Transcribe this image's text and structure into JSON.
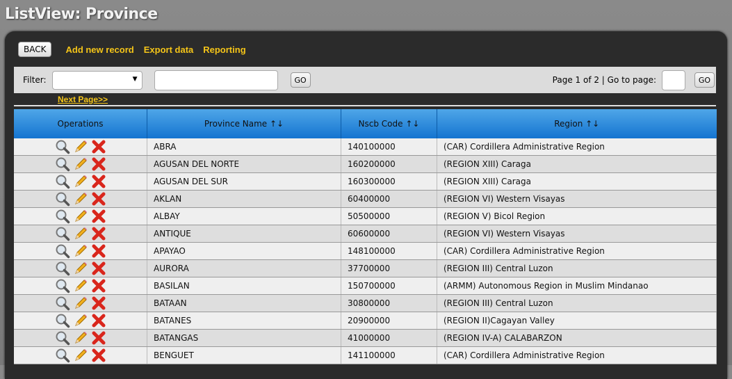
{
  "title": "ListView: Province",
  "toolbar": {
    "back_label": "BACK",
    "links": [
      "Add new record",
      "Export data",
      "Reporting"
    ]
  },
  "filter": {
    "label": "Filter:",
    "select_value": "",
    "search_value": "",
    "go_label": "GO"
  },
  "pager": {
    "text": "Page 1 of 2 | Go to page:",
    "goto_value": "",
    "go_label": "GO",
    "next_label": "Next Page>>"
  },
  "table": {
    "headers": [
      "Operations",
      "Province Name ↑↓",
      "Nscb Code ↑↓",
      "Region ↑↓"
    ],
    "rows": [
      [
        "ABRA",
        "140100000",
        "(CAR) Cordillera Administrative Region"
      ],
      [
        "AGUSAN DEL NORTE",
        "160200000",
        "(REGION XIII) Caraga"
      ],
      [
        "AGUSAN DEL SUR",
        "160300000",
        "(REGION XIII) Caraga"
      ],
      [
        "AKLAN",
        "60400000",
        "(REGION VI) Western Visayas"
      ],
      [
        "ALBAY",
        "50500000",
        "(REGION V) Bicol Region"
      ],
      [
        "ANTIQUE",
        "60600000",
        "(REGION VI) Western Visayas"
      ],
      [
        "APAYAO",
        "148100000",
        "(CAR) Cordillera Administrative Region"
      ],
      [
        "AURORA",
        "37700000",
        "(REGION III) Central Luzon"
      ],
      [
        "BASILAN",
        "150700000",
        "(ARMM) Autonomous Region in Muslim Mindanao"
      ],
      [
        "BATAAN",
        "30800000",
        "(REGION III) Central Luzon"
      ],
      [
        "BATANES",
        "20900000",
        "(REGION II)Cagayan Valley"
      ],
      [
        "BATANGAS",
        "41000000",
        "(REGION IV-A) CALABARZON"
      ],
      [
        "BENGUET",
        "141100000",
        "(CAR) Cordillera Administrative Region"
      ]
    ]
  },
  "colors": {
    "link": "#f5c518",
    "header": "#1e88e5",
    "delete": "#d9261c"
  },
  "icons": [
    "view-icon",
    "edit-icon",
    "delete-icon"
  ]
}
